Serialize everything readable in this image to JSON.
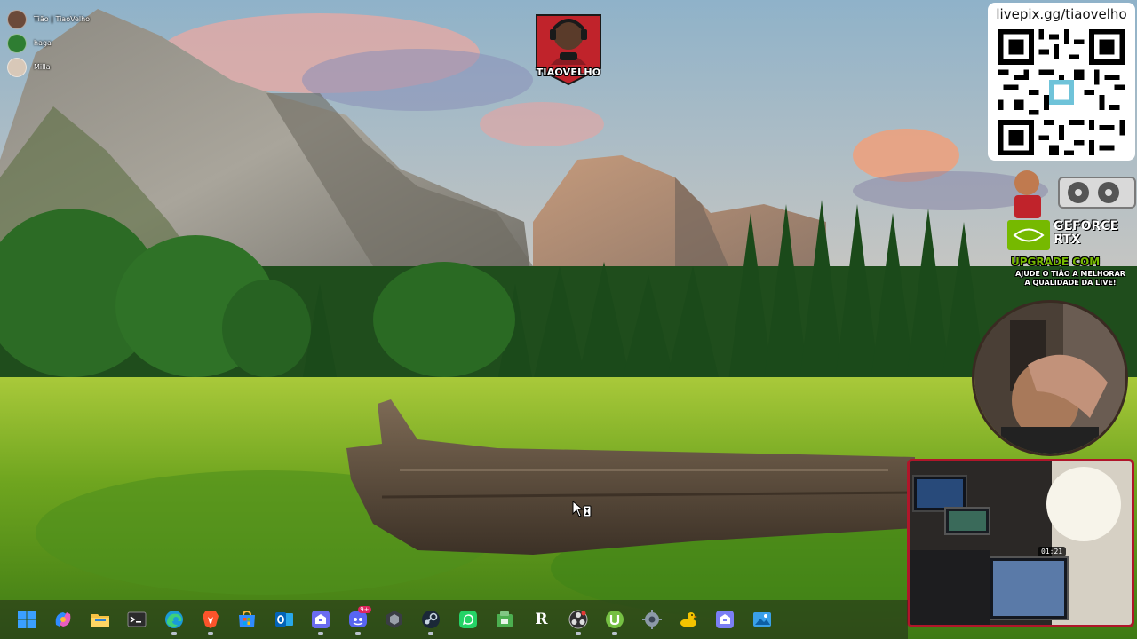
{
  "voice_overlay": {
    "users": [
      {
        "name": "Tião | TiaoVelho",
        "avatar_color": "#6b4a3a"
      },
      {
        "name": "haga",
        "avatar_color": "#2e7d32"
      },
      {
        "name": "Milla",
        "avatar_color": "#d8c8b8"
      }
    ]
  },
  "stream_logo": {
    "text": "TIAOVELHO",
    "color": "#c0232b"
  },
  "livepix": {
    "url": "livepix.gg/tiaovelho"
  },
  "gpu_ad": {
    "vendor": "NVIDIA",
    "product_line1": "GEFORCE",
    "product_line2": "RTX",
    "headline": "UPGRADE COM",
    "subline1": "AJUDE O TIÃO A MELHORAR",
    "subline2": "A QUALIDADE DA LIVE!",
    "accent": "#76b900"
  },
  "webcam_room": {
    "clock": "01:21"
  },
  "taskbar": {
    "icons": [
      {
        "name": "windows-start-icon",
        "running": false
      },
      {
        "name": "copilot-icon",
        "running": false
      },
      {
        "name": "file-explorer-icon",
        "running": false
      },
      {
        "name": "terminal-icon",
        "running": false
      },
      {
        "name": "edge-browser-icon",
        "running": true
      },
      {
        "name": "brave-browser-icon",
        "running": true
      },
      {
        "name": "microsoft-store-icon",
        "running": false
      },
      {
        "name": "outlook-icon",
        "running": false
      },
      {
        "name": "streamlabs-icon",
        "running": true
      },
      {
        "name": "discord-icon",
        "running": true,
        "badge": "9+"
      },
      {
        "name": "epic-games-icon",
        "running": false
      },
      {
        "name": "steam-icon",
        "running": true
      },
      {
        "name": "whatsapp-icon",
        "running": false
      },
      {
        "name": "app-green-icon",
        "running": false
      },
      {
        "name": "r-app-icon",
        "running": false,
        "letter": "R"
      },
      {
        "name": "obs-icon",
        "running": true
      },
      {
        "name": "utorrent-icon",
        "running": true
      },
      {
        "name": "settings-gear-icon",
        "running": false
      },
      {
        "name": "cyberduck-icon",
        "running": false
      },
      {
        "name": "streamlabs-2-icon",
        "running": false
      },
      {
        "name": "photos-icon",
        "running": false
      }
    ]
  }
}
